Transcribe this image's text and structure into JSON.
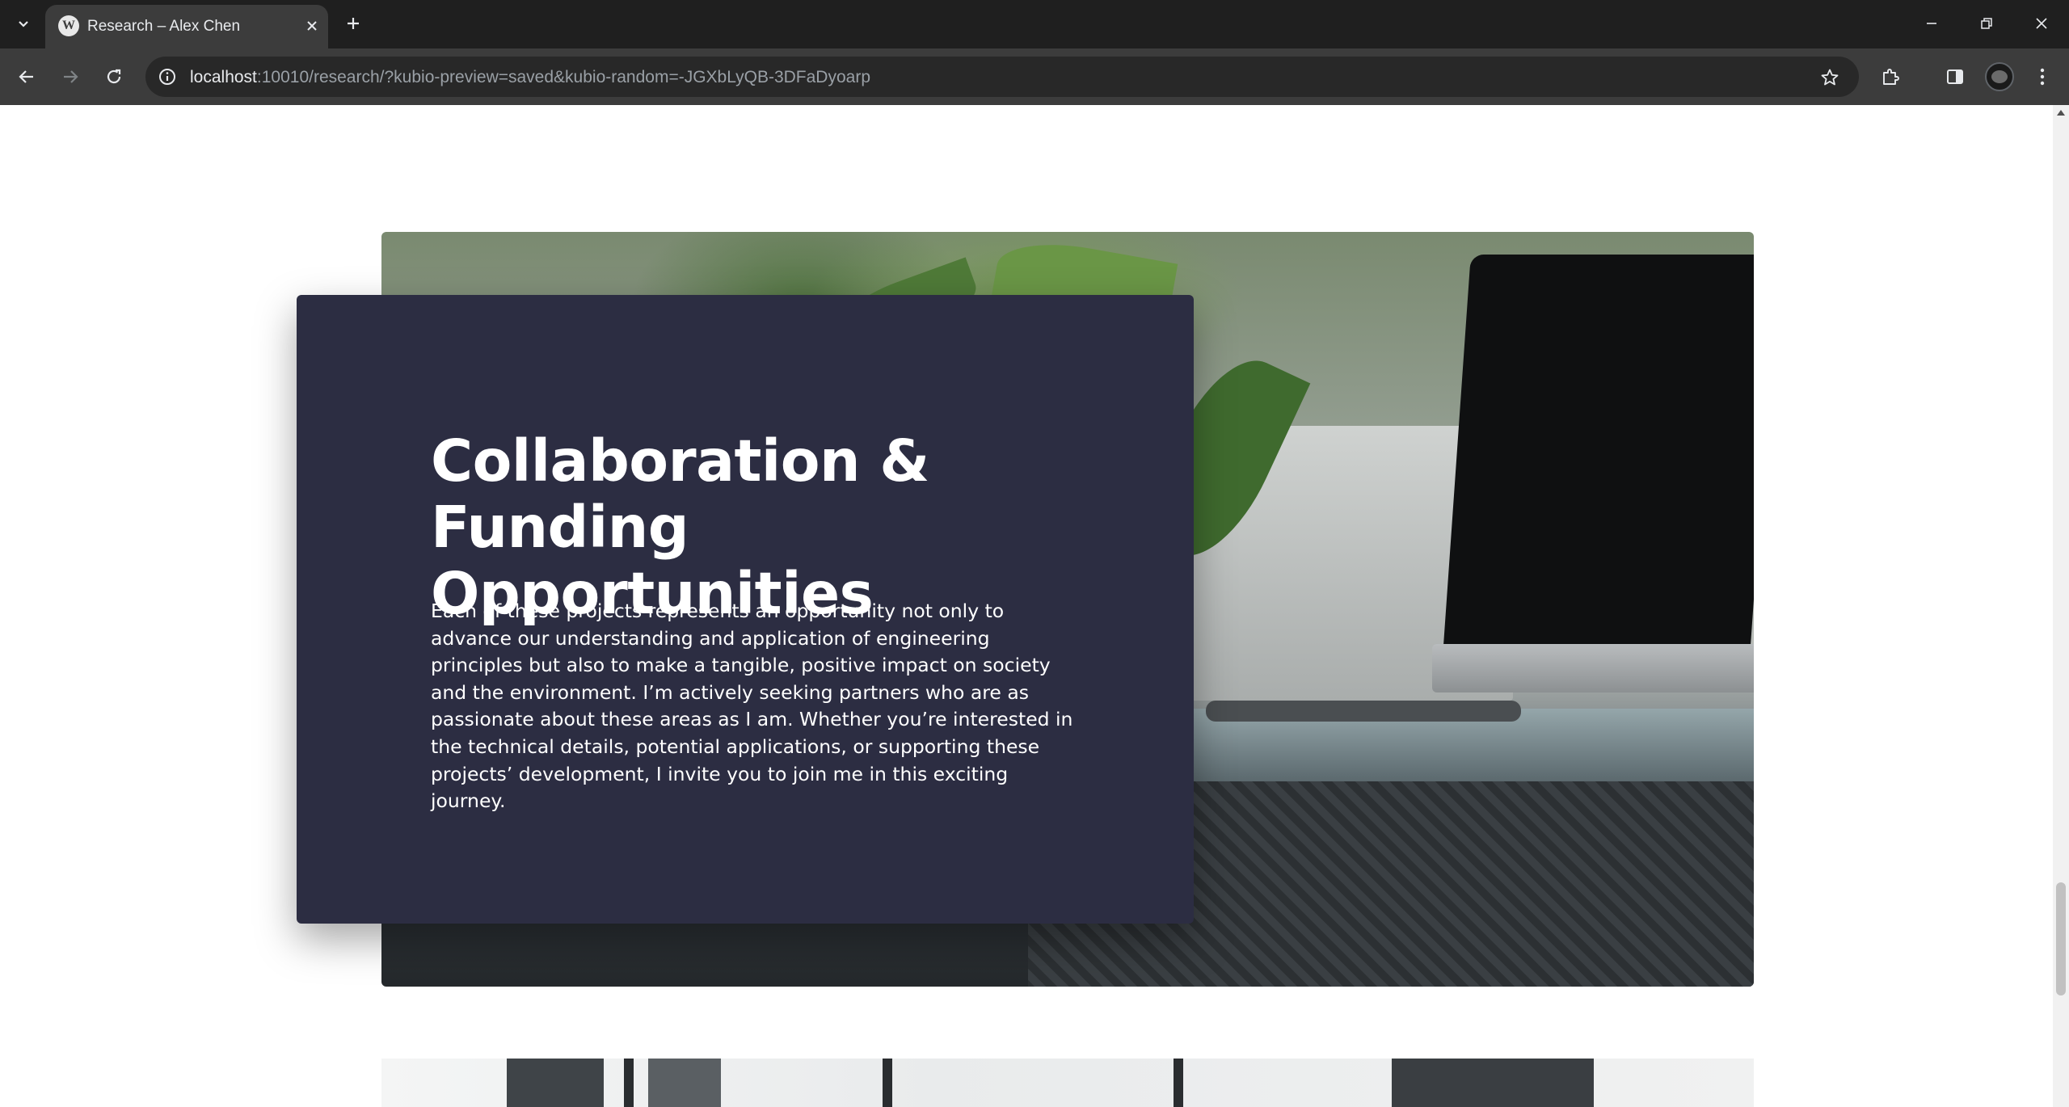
{
  "browser": {
    "tab_title": "Research – Alex Chen",
    "url_host": "localhost",
    "url_rest": ":10010/research/?kubio-preview=saved&kubio-random=-JGXbLyQB-3DFaDyoarp"
  },
  "section": {
    "heading": "Collaboration & Funding Opportunities",
    "body": "Each of these projects represents an opportunity not only to advance our understanding and application of engineering principles but also to make a tangible, positive impact on society and the environment. I’m actively seeking partners who are as passionate about these areas as I am. Whether you’re interested in the technical details, potential applications, or supporting these projects’ development, I invite you to join me in this exciting journey.",
    "card_color": "#2c2d42"
  },
  "icons": {
    "tab_list": "chevron-down-icon",
    "favicon": "wordpress-icon",
    "close": "close-icon",
    "new_tab": "plus-icon",
    "minimize": "minimize-icon",
    "restore": "restore-icon",
    "close_window": "close-window-icon",
    "back": "back-arrow-icon",
    "forward": "forward-arrow-icon",
    "reload": "reload-icon",
    "site_info": "info-icon",
    "bookmark": "star-icon",
    "extensions": "puzzle-icon",
    "side_panel": "side-panel-icon",
    "menu": "kebab-menu-icon"
  }
}
